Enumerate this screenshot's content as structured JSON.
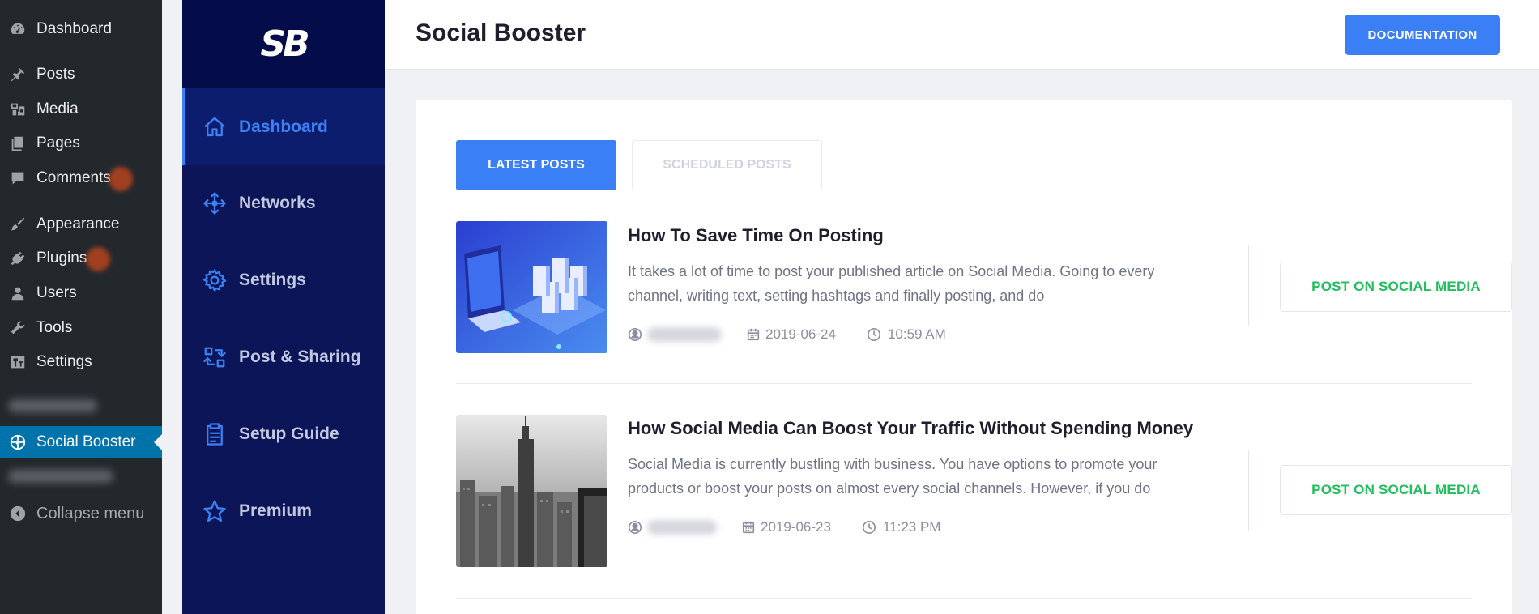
{
  "wp_menu": {
    "items": [
      {
        "label": "Dashboard",
        "icon": "dashboard-icon"
      },
      {
        "label": "Posts",
        "icon": "pushpin-icon"
      },
      {
        "label": "Media",
        "icon": "media-icon"
      },
      {
        "label": "Pages",
        "icon": "pages-icon"
      },
      {
        "label": "Comments",
        "icon": "comment-icon"
      },
      {
        "label": "Appearance",
        "icon": "paintbrush-icon"
      },
      {
        "label": "Plugins",
        "icon": "plug-icon"
      },
      {
        "label": "Users",
        "icon": "user-icon"
      },
      {
        "label": "Tools",
        "icon": "wrench-icon"
      },
      {
        "label": "Settings",
        "icon": "sliders-icon"
      }
    ],
    "active_item": {
      "label": "Social Booster",
      "icon": "social-booster-icon"
    },
    "collapse_label": "Collapse menu",
    "accent_color": "#0073aa"
  },
  "plugin_sidebar": {
    "logo_text": "SB",
    "items": [
      {
        "label": "Dashboard",
        "icon": "home-icon",
        "active": true
      },
      {
        "label": "Networks",
        "icon": "move-arrows-icon",
        "active": false
      },
      {
        "label": "Settings",
        "icon": "gear-icon",
        "active": false
      },
      {
        "label": "Post & Sharing",
        "icon": "share-arrows-icon",
        "active": false
      },
      {
        "label": "Setup Guide",
        "icon": "clipboard-icon",
        "active": false
      },
      {
        "label": "Premium",
        "icon": "star-icon",
        "active": false
      }
    ],
    "background_color": "#0b1557",
    "accent_color": "#3b82f6"
  },
  "header": {
    "title": "Social Booster",
    "documentation_label": "DOCUMENTATION"
  },
  "tabs": {
    "latest_label": "LATEST POSTS",
    "scheduled_label": "SCHEDULED POSTS"
  },
  "posts": [
    {
      "title": "How To Save Time On Posting",
      "excerpt": "It takes a lot of time to post your published article on Social Media. Going to every channel, writing text, setting hashtags and finally posting, and do",
      "date": "2019-06-24",
      "time": "10:59 AM",
      "share_label": "POST ON SOCIAL MEDIA",
      "thumbnail": "server-laptop-illustration"
    },
    {
      "title": "How Social Media Can Boost Your Traffic Without Spending Money",
      "excerpt": "Social Media is currently bustling with business. You have options to promote your products or boost your posts on almost every social channels. However, if you do",
      "date": "2019-06-23",
      "time": "11:23 PM",
      "share_label": "POST ON SOCIAL MEDIA",
      "thumbnail": "city-skyline-photo"
    }
  ],
  "colors": {
    "primary": "#3a7ff5",
    "share_green": "#1fbf5c"
  }
}
